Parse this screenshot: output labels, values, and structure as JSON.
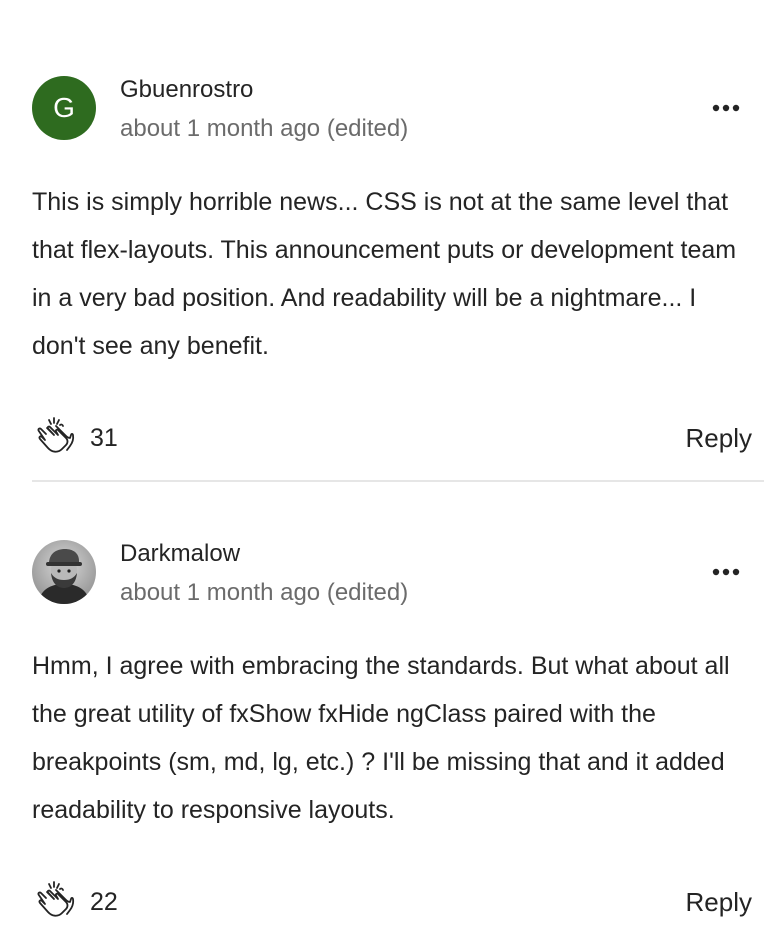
{
  "comments": [
    {
      "author": "Gbuenrostro",
      "avatar_initial": "G",
      "avatar_color": "#2e6b1f",
      "timestamp": "about 1 month ago (edited)",
      "body": "This is simply horrible news... CSS is not at the same level that that flex-layouts. This announcement puts or development team in a very bad position. And readability will be a nightmare... I don't see any benefit.",
      "claps": "31",
      "reply_label": "Reply",
      "more_icon": "more-horizontal-icon",
      "clap_icon": "clap-icon"
    },
    {
      "author": "Darkmalow",
      "avatar_type": "photo",
      "timestamp": "about 1 month ago (edited)",
      "body": "Hmm, I agree with embracing the standards. But what about all the great utility of fxShow fxHide ngClass paired with the breakpoints (sm, md, lg, etc.) ? I'll be missing that and it added readability to responsive layouts.",
      "claps": "22",
      "reply_label": "Reply",
      "more_icon": "more-horizontal-icon",
      "clap_icon": "clap-icon"
    }
  ],
  "colors": {
    "text": "#242424",
    "muted": "#6b6b6b",
    "divider": "#e6e6e6"
  }
}
